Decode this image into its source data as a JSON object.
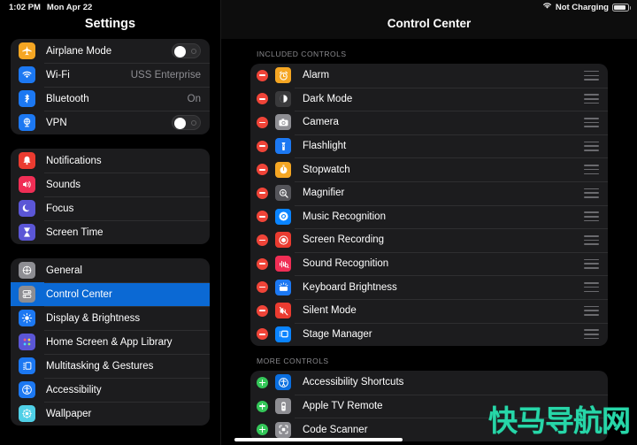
{
  "status_bar": {
    "time": "1:02 PM",
    "date": "Mon Apr 22",
    "wifi_icon": "wifi-icon",
    "battery_text": "Not Charging",
    "battery_icon": "battery-icon"
  },
  "sidebar": {
    "title": "Settings",
    "groups": [
      {
        "items": [
          {
            "label": "Airplane Mode",
            "icon": "airplane-icon",
            "icon_bg": "#f5a623",
            "control": "toggle",
            "value": ""
          },
          {
            "label": "Wi-Fi",
            "icon": "wifi-icon",
            "icon_bg": "#1c78f2",
            "control": "value",
            "value": "USS Enterprise"
          },
          {
            "label": "Bluetooth",
            "icon": "bluetooth-icon",
            "icon_bg": "#1c78f2",
            "control": "value",
            "value": "On"
          },
          {
            "label": "VPN",
            "icon": "vpn-globe-icon",
            "icon_bg": "#1c78f2",
            "control": "toggle",
            "value": ""
          }
        ]
      },
      {
        "items": [
          {
            "label": "Notifications",
            "icon": "bell-icon",
            "icon_bg": "#eb3b30",
            "control": "none",
            "value": ""
          },
          {
            "label": "Sounds",
            "icon": "speaker-icon",
            "icon_bg": "#f02e55",
            "control": "none",
            "value": ""
          },
          {
            "label": "Focus",
            "icon": "moon-icon",
            "icon_bg": "#5b56d6",
            "control": "none",
            "value": ""
          },
          {
            "label": "Screen Time",
            "icon": "hourglass-icon",
            "icon_bg": "#5b56d6",
            "control": "none",
            "value": ""
          }
        ]
      },
      {
        "items": [
          {
            "label": "General",
            "icon": "gear-icon",
            "icon_bg": "#8e8e93",
            "control": "none",
            "value": "",
            "selected": false
          },
          {
            "label": "Control Center",
            "icon": "control-center-icon",
            "icon_bg": "#8e8e93",
            "control": "none",
            "value": "",
            "selected": true
          },
          {
            "label": "Display & Brightness",
            "icon": "brightness-icon",
            "icon_bg": "#1c78f2",
            "control": "none",
            "value": "",
            "selected": false
          },
          {
            "label": "Home Screen & App Library",
            "icon": "app-grid-icon",
            "icon_bg": "#5b56d6",
            "control": "none",
            "value": "",
            "selected": false
          },
          {
            "label": "Multitasking & Gestures",
            "icon": "multitasking-icon",
            "icon_bg": "#1c78f2",
            "control": "none",
            "value": "",
            "selected": false
          },
          {
            "label": "Accessibility",
            "icon": "accessibility-icon",
            "icon_bg": "#1c78f2",
            "control": "none",
            "value": "",
            "selected": false
          },
          {
            "label": "Wallpaper",
            "icon": "wallpaper-icon",
            "icon_bg": "#4fd0e7",
            "control": "none",
            "value": "",
            "selected": false
          }
        ]
      }
    ]
  },
  "detail": {
    "title": "Control Center",
    "included_header": "INCLUDED CONTROLS",
    "more_header": "MORE CONTROLS",
    "included": [
      {
        "label": "Alarm",
        "icon": "alarm-clock-icon",
        "icon_bg": "#f5a623",
        "action": "remove"
      },
      {
        "label": "Dark Mode",
        "icon": "dark-mode-icon",
        "icon_bg": "#3a3a3c",
        "action": "remove"
      },
      {
        "label": "Camera",
        "icon": "camera-icon",
        "icon_bg": "#8e8e93",
        "action": "remove"
      },
      {
        "label": "Flashlight",
        "icon": "flashlight-icon",
        "icon_bg": "#1c78f2",
        "action": "remove"
      },
      {
        "label": "Stopwatch",
        "icon": "stopwatch-icon",
        "icon_bg": "#f5a623",
        "action": "remove"
      },
      {
        "label": "Magnifier",
        "icon": "magnifier-icon",
        "icon_bg": "#55555a",
        "action": "remove"
      },
      {
        "label": "Music Recognition",
        "icon": "shazam-icon",
        "icon_bg": "#0a84ff",
        "action": "remove"
      },
      {
        "label": "Screen Recording",
        "icon": "screen-recording-icon",
        "icon_bg": "#eb3b30",
        "action": "remove"
      },
      {
        "label": "Sound Recognition",
        "icon": "sound-recognition-icon",
        "icon_bg": "#f02e55",
        "action": "remove"
      },
      {
        "label": "Keyboard Brightness",
        "icon": "keyboard-brightness-icon",
        "icon_bg": "#1c78f2",
        "action": "remove"
      },
      {
        "label": "Silent Mode",
        "icon": "silent-mode-icon",
        "icon_bg": "#eb3b30",
        "action": "remove"
      },
      {
        "label": "Stage Manager",
        "icon": "stage-manager-icon",
        "icon_bg": "#0a84ff",
        "action": "remove"
      }
    ],
    "more": [
      {
        "label": "Accessibility Shortcuts",
        "icon": "accessibility-icon",
        "icon_bg": "#0a6fe0",
        "action": "add"
      },
      {
        "label": "Apple TV Remote",
        "icon": "apple-tv-remote-icon",
        "icon_bg": "#8e8e93",
        "action": "add"
      },
      {
        "label": "Code Scanner",
        "icon": "code-scanner-icon",
        "icon_bg": "#8e8e93",
        "action": "add"
      }
    ]
  },
  "watermark": {
    "text": "快马导航网"
  }
}
